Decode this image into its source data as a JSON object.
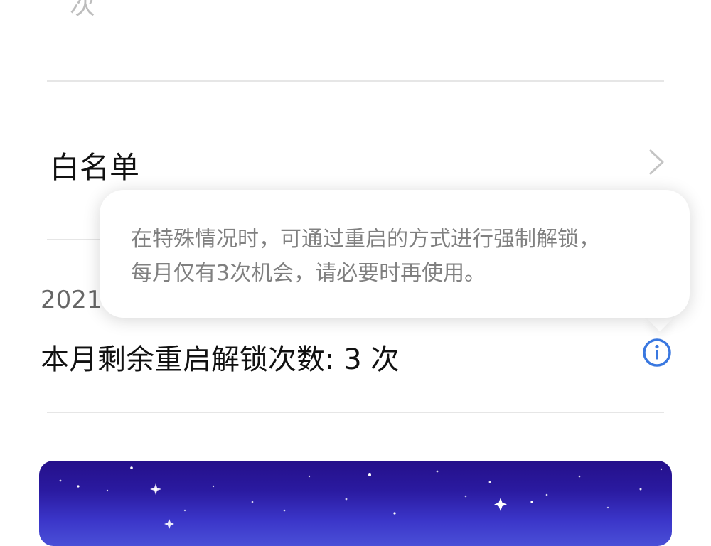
{
  "top_partial_char": "次",
  "whitelist": {
    "label": "白名单",
    "chevron_icon": "chevron-right-icon"
  },
  "year_fragment": "2021",
  "remaining": {
    "label": "本月剩余重启解锁次数: 3 次",
    "count": 3,
    "info_icon": "info-icon",
    "accent_color": "#3a78e0"
  },
  "tooltip": {
    "line1": "在特殊情况时，可通过重启的方式进行强制解锁，",
    "line2": "每月仅有3次机会，请必要时再使用。"
  },
  "banner": {
    "gradient_top": "#25108a",
    "gradient_bottom": "#4a4fd7"
  }
}
